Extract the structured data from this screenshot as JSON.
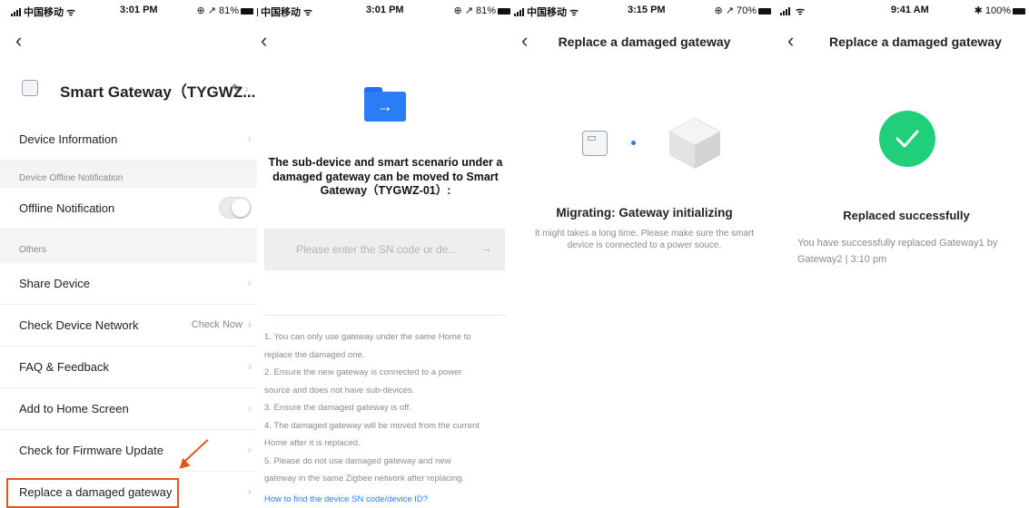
{
  "screen1": {
    "status": {
      "carrier": "中国移动",
      "time": "3:01 PM",
      "right": "⊕ ↗ 81%"
    },
    "device_name": "Smart Gateway（TYGWZ...",
    "rows": {
      "device_information": "Device Information",
      "section_offline": "Device Offline Notification",
      "offline_notification": "Offline Notification",
      "section_others": "Others",
      "share_device": "Share Device",
      "check_network": "Check Device Network",
      "check_now": "Check Now",
      "faq": "FAQ & Feedback",
      "add_home": "Add to Home Screen",
      "firmware": "Check for Firmware Update",
      "replace": "Replace a damaged gateway"
    }
  },
  "screen2": {
    "status": {
      "carrier": "中国移动",
      "time": "3:01 PM",
      "right": "⊕ ↗ 81%"
    },
    "headline": "The sub-device and smart scenario under a damaged gateway can be moved to Smart Gateway（TYGWZ-01）:",
    "input_placeholder": "Please enter the SN code or de...",
    "notes": [
      "1. You can only use gateway under the same Home to",
      "replace the damaged one.",
      "2. Ensure the new gateway is connected to a power",
      "source and does not have sub-devices.",
      "3. Ensure the damaged gateway is off.",
      "4. The damaged gateway will be moved from the current",
      "Home after it is replaced.",
      "5. Please do not use damaged gateway and new",
      "gateway in the same Zigbee network after replacing."
    ],
    "help_link": "How to find the device SN code/device ID?"
  },
  "screen3": {
    "status": {
      "carrier": "中国移动",
      "time": "3:15 PM",
      "right": "⊕ ↗ 70%"
    },
    "title": "Replace a damaged gateway",
    "status_title": "Migrating: Gateway initializing",
    "status_desc": "It might takes a long time. Please make sure the smart device is connected to a power souce."
  },
  "screen4": {
    "status": {
      "time": "9:41 AM",
      "right": "✱ 100%"
    },
    "title": "Replace a damaged gateway",
    "result_title": "Replaced successfully",
    "result_desc": "You have successfully replaced Gateway1 by Gateway2 | 3:10 pm"
  },
  "colors": {
    "accent_blue": "#2a7cf7",
    "success_green": "#21cf7b",
    "highlight_orange": "#e2571d"
  }
}
